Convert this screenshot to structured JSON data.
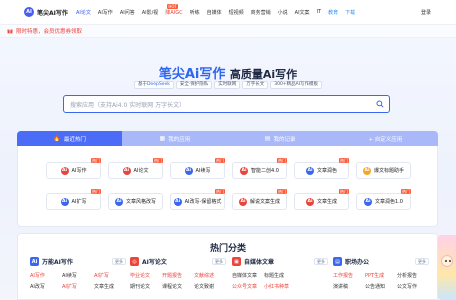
{
  "nav": {
    "logo_mark": "AI",
    "logo_text": "笔尖AI写作",
    "links": [
      {
        "label": "AI论文",
        "style": "active"
      },
      {
        "label": "AI写作",
        "style": ""
      },
      {
        "label": "AI问答",
        "style": ""
      },
      {
        "label": "AI影/视",
        "style": ""
      },
      {
        "label": "降AIGC",
        "style": "red"
      },
      {
        "label": "听练",
        "style": ""
      },
      {
        "label": "自媒体",
        "style": ""
      },
      {
        "label": "短视频",
        "style": ""
      },
      {
        "label": "商务营销",
        "style": ""
      },
      {
        "label": "小说",
        "style": ""
      },
      {
        "label": "AI文案",
        "style": ""
      },
      {
        "label": "IT",
        "style": ""
      },
      {
        "label": "教育",
        "style": "blue"
      },
      {
        "label": "下载",
        "style": "blue"
      }
    ],
    "hot_badge": "HOT",
    "login": "登录"
  },
  "promo": {
    "text": "限时特惠，会员优惠券领取"
  },
  "hero": {
    "brand": "笔尖Ai写作",
    "rest": "高质量Ai写作",
    "tags": [
      {
        "pre": "基于",
        "hl": "DeepSeek",
        "post": ""
      },
      {
        "pre": "安全·保护隐私",
        "hl": "",
        "post": ""
      },
      {
        "pre": "实时联网",
        "hl": "",
        "post": ""
      },
      {
        "pre": "万字长文",
        "hl": "",
        "post": ""
      },
      {
        "pre": "300+精品AI写作模板",
        "hl": "",
        "post": ""
      }
    ]
  },
  "search": {
    "placeholder": "搜索应用（支持Ai4.0 实时联网 万字长文）"
  },
  "tabs": [
    {
      "label": "最近热门",
      "icon": "🔥",
      "active": true
    },
    {
      "label": "我的应用",
      "icon": "▦",
      "active": false
    },
    {
      "label": "我的记录",
      "icon": "▤",
      "active": false
    },
    {
      "label": "+ 自定义应用",
      "icon": "",
      "active": false
    }
  ],
  "cards": [
    {
      "label": "AI写作",
      "color": "#e8453c",
      "hot": "热门"
    },
    {
      "label": "AI论文",
      "color": "#e8453c",
      "hot": "热门"
    },
    {
      "label": "AI续写",
      "color": "#3a66f0",
      "hot": "热门"
    },
    {
      "label": "智能二创4.0",
      "color": "#e8453c",
      "hot": "热门"
    },
    {
      "label": "文章润色",
      "color": "#3a66f0",
      "hot": "热门"
    },
    {
      "label": "爆文标题助手",
      "color": "#f5a623",
      "hot": ""
    },
    {
      "label": "AI扩写",
      "color": "#3a66f0",
      "hot": "热门"
    },
    {
      "label": "文章风格改写",
      "color": "#3a66f0",
      "hot": ""
    },
    {
      "label": "AI改写-保留格式",
      "color": "#3a66f0",
      "hot": "热门"
    },
    {
      "label": "解说文案生成",
      "color": "#e8453c",
      "hot": "热门"
    },
    {
      "label": "文章生成",
      "color": "#e8453c",
      "hot": "热门"
    },
    {
      "label": "文章润色1.0",
      "color": "#3a66f0",
      "hot": "热门"
    }
  ],
  "categories": {
    "title": "热门分类",
    "more": "更多",
    "columns": [
      {
        "head": "万能AI写作",
        "icon": "Ai",
        "color": "#3a66f0",
        "items": [
          {
            "label": "AI写作",
            "hot": true
          },
          {
            "label": "AI续写",
            "hot": false
          },
          {
            "label": "AI扩写",
            "hot": true
          },
          {
            "label": "AI改写",
            "hot": false
          },
          {
            "label": "AI扩写",
            "hot": true
          },
          {
            "label": "文章生成",
            "hot": false
          }
        ]
      },
      {
        "head": "AI写论文",
        "icon": "◎",
        "color": "#e8453c",
        "items": [
          {
            "label": "毕业论文",
            "hot": true
          },
          {
            "label": "开题报告",
            "hot": true
          },
          {
            "label": "文献综述",
            "hot": true
          },
          {
            "label": "期刊论文",
            "hot": false
          },
          {
            "label": "课程论文",
            "hot": false
          },
          {
            "label": "论文致谢",
            "hot": false
          }
        ]
      },
      {
        "head": "自媒体文章",
        "icon": "▣",
        "color": "#e8453c",
        "items": [
          {
            "label": "自媒体文章",
            "hot": false
          },
          {
            "label": "标题生成",
            "hot": false
          },
          {
            "label": "",
            "hot": false
          },
          {
            "label": "公众号文章",
            "hot": true
          },
          {
            "label": "小红书种草",
            "hot": true
          },
          {
            "label": "",
            "hot": false
          }
        ]
      },
      {
        "head": "职场办公",
        "icon": "▤",
        "color": "#3a66f0",
        "items": [
          {
            "label": "工作报告",
            "hot": true
          },
          {
            "label": "PPT生成",
            "hot": true
          },
          {
            "label": "分析报告",
            "hot": false
          },
          {
            "label": "演讲稿",
            "hot": false
          },
          {
            "label": "公告通知",
            "hot": false
          },
          {
            "label": "公文写作",
            "hot": false
          }
        ]
      }
    ]
  }
}
